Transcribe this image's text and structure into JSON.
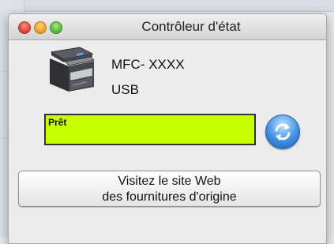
{
  "window": {
    "title": "Contrôleur d'état"
  },
  "device": {
    "model": "MFC- XXXX",
    "connection": "USB",
    "icon": "printer-icon"
  },
  "status": {
    "text": "Prêt",
    "color": "#c8ff00"
  },
  "refresh": {
    "icon": "refresh-icon"
  },
  "web_button": {
    "line1": "Visitez le site Web",
    "line2": "des fournitures d'origine"
  }
}
